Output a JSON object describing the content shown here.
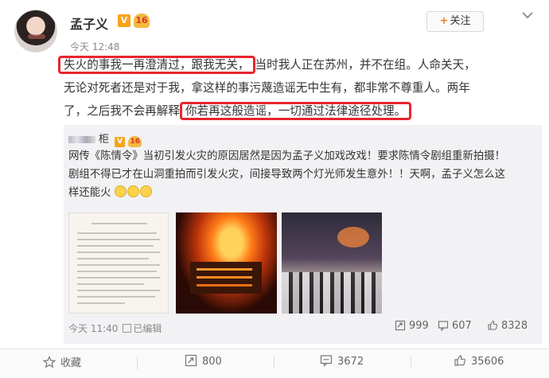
{
  "header": {
    "username": "孟子义",
    "verified_badge": "V",
    "vip_badge": "16",
    "time": "今天 12:48",
    "follow_label": "关注",
    "icons": {
      "more": "chevron-down-icon",
      "follow": "plus-icon"
    }
  },
  "post": {
    "lines": [
      [
        "失火的事我一再澄清过，跟我无关，",
        "当时我人正在苏州，并不在组。人命关天，"
      ],
      [
        "无论对死者还是对于我，拿这样的事污蔑造谣无中生有，都非常不尊重人。两年"
      ],
      [
        "了，之后我不会再解释",
        "你若再这般造谣，一切通过法律途径处理。"
      ]
    ]
  },
  "repost": {
    "user_suffix": "柜",
    "text_lines": [
      "网传《陈情令》当初引发火灾的原因居然是因为孟子义加戏改戏！要求陈情令剧组重新拍摄！",
      "剧组不得已才在山洞重拍而引发火灾，间接导致两个灯光师发生意外！！天啊，孟子义怎么这",
      "样还能火"
    ],
    "images": [
      "document-photo",
      "fire-photo",
      "crowd-photo"
    ],
    "meta": {
      "time": "今天 11:40",
      "edit_label": "已编辑"
    },
    "stats": {
      "reposts": "999",
      "comments": "607",
      "likes": "8328"
    }
  },
  "actions": {
    "favorite": "收藏",
    "repost_count": "800",
    "comment_count": "3672",
    "like_count": "35606"
  },
  "colors": {
    "highlight": "#e8252e",
    "repost_bg": "#f2f2f5",
    "badge": "#f7a31a"
  }
}
